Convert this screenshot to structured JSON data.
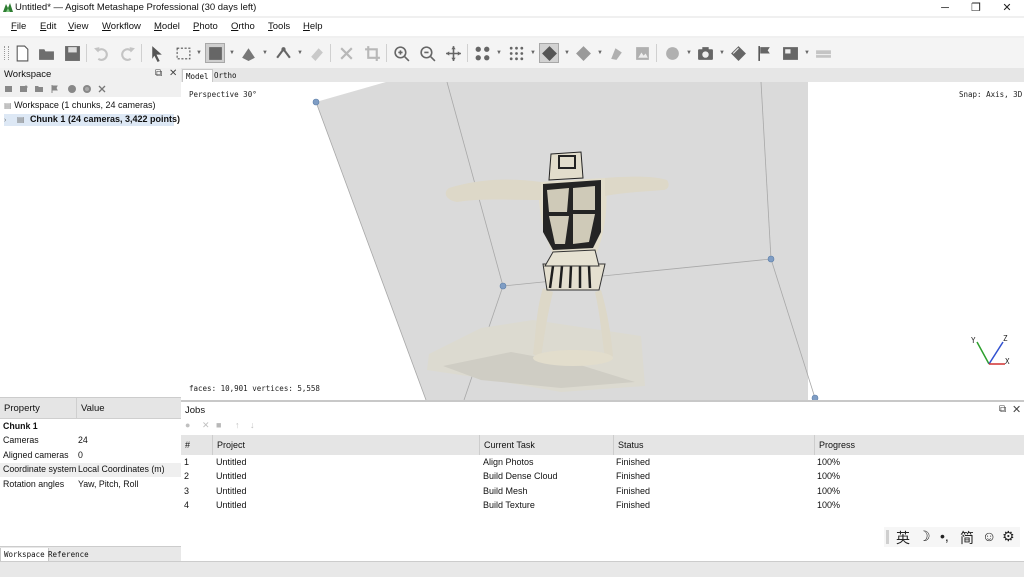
{
  "window": {
    "title": "Untitled* — Agisoft Metashape Professional (30 days left)",
    "minimize": "─",
    "restore": "❐",
    "close": "✕"
  },
  "menu": [
    {
      "label": "File",
      "key": "F",
      "rest": "ile"
    },
    {
      "label": "Edit",
      "key": "E",
      "rest": "dit"
    },
    {
      "label": "View",
      "key": "V",
      "rest": "iew"
    },
    {
      "label": "Workflow",
      "key": "W",
      "rest": "orkflow"
    },
    {
      "label": "Model",
      "key": "M",
      "rest": "odel"
    },
    {
      "label": "Photo",
      "key": "P",
      "rest": "hoto"
    },
    {
      "label": "Ortho",
      "key": "O",
      "rest": "rtho"
    },
    {
      "label": "Tools",
      "key": "T",
      "rest": "ools"
    },
    {
      "label": "Help",
      "key": "H",
      "rest": "elp"
    }
  ],
  "workspace": {
    "title": "Workspace",
    "root_label": "Workspace (1 chunks, 24 cameras)",
    "chunk_label": "Chunk 1 (24 cameras, 3,422 points)"
  },
  "properties": {
    "col_property": "Property",
    "col_value": "Value",
    "section": "Chunk 1",
    "rows": [
      {
        "property": "Cameras",
        "value": "24"
      },
      {
        "property": "Aligned cameras",
        "value": "0"
      },
      {
        "property": "Coordinate system",
        "value": "Local Coordinates (m)"
      },
      {
        "property": "Rotation angles",
        "value": "Yaw, Pitch, Roll"
      }
    ]
  },
  "bottom_tabs": [
    "Workspace",
    "Reference"
  ],
  "viewport": {
    "tabs": [
      "Model",
      "Ortho"
    ],
    "projection": "Perspective 30°",
    "snap": "Snap: Axis, 3D",
    "stats": "faces: 10,901 vertices: 5,558",
    "axis_y": "Y",
    "axis_z": "Z",
    "axis_x": "X"
  },
  "jobs": {
    "title": "Jobs",
    "columns": [
      "#",
      "Project",
      "Current Task",
      "Status",
      "Progress"
    ],
    "rows": [
      {
        "num": "1",
        "project": "Untitled",
        "task": "Align Photos",
        "status": "Finished",
        "progress": "100%"
      },
      {
        "num": "2",
        "project": "Untitled",
        "task": "Build Dense Cloud",
        "status": "Finished",
        "progress": "100%"
      },
      {
        "num": "3",
        "project": "Untitled",
        "task": "Build Mesh",
        "status": "Finished",
        "progress": "100%"
      },
      {
        "num": "4",
        "project": "Untitled",
        "task": "Build Texture",
        "status": "Finished",
        "progress": "100%"
      }
    ]
  },
  "ime": [
    "英",
    "☽",
    "•,",
    "简",
    "☺",
    "⚙"
  ],
  "colors": {
    "accent": "#3d7fd6",
    "selection": "#dde8f5",
    "header": "#e5e5e5"
  }
}
